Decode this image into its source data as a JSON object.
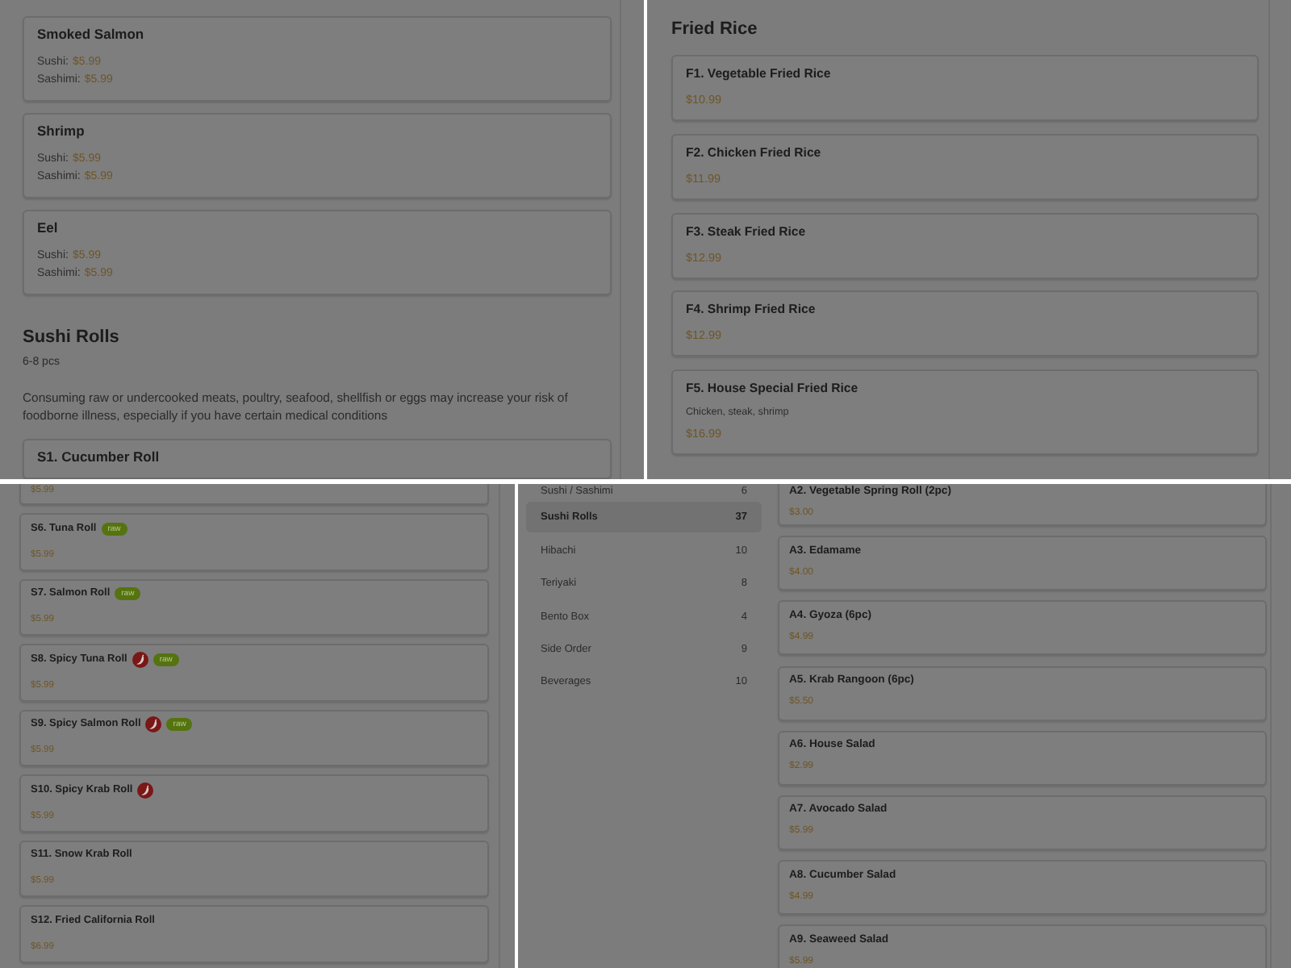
{
  "panels": [
    {
      "blocks": [
        {
          "kind": "card",
          "title": "Smoked Salmon",
          "prices": [
            {
              "label": "Sushi:",
              "price": "$5.99"
            },
            {
              "label": "Sashimi:",
              "price": "$5.99"
            }
          ]
        },
        {
          "kind": "card",
          "title": "Shrimp",
          "prices": [
            {
              "label": "Sushi:",
              "price": "$5.99"
            },
            {
              "label": "Sashimi:",
              "price": "$5.99"
            }
          ]
        },
        {
          "kind": "card",
          "title": "Eel",
          "prices": [
            {
              "label": "Sushi:",
              "price": "$5.99"
            },
            {
              "label": "Sashimi:",
              "price": "$5.99"
            }
          ]
        },
        {
          "kind": "heading",
          "text": "Sushi Rolls"
        },
        {
          "kind": "subtitle",
          "text": "6-8 pcs"
        },
        {
          "kind": "note",
          "text": "Consuming raw or undercooked meats, poultry, seafood, shellfish or eggs may increase your risk of foodborne illness, especially if you have certain medical conditions"
        },
        {
          "kind": "card",
          "title": "S1. Cucumber Roll"
        }
      ]
    },
    {
      "blocks": [
        {
          "kind": "heading",
          "text": "Fried Rice"
        },
        {
          "kind": "card",
          "title": "F1. Vegetable Fried Rice",
          "price": "$10.99"
        },
        {
          "kind": "card",
          "title": "F2. Chicken Fried Rice",
          "price": "$11.99"
        },
        {
          "kind": "card",
          "title": "F3. Steak Fried Rice",
          "price": "$12.99"
        },
        {
          "kind": "card",
          "title": "F4. Shrimp Fried Rice",
          "price": "$12.99"
        },
        {
          "kind": "card",
          "title": "F5. House Special Fried Rice",
          "description": "Chicken, steak, shrimp",
          "price": "$16.99"
        }
      ]
    },
    {
      "blocks": [
        {
          "kind": "card",
          "price": "$5.99"
        },
        {
          "kind": "card",
          "title": "S6. Tuna Roll",
          "tags": [
            {
              "kind": "raw",
              "label": "raw"
            }
          ],
          "price": "$5.99"
        },
        {
          "kind": "card",
          "title": "S7. Salmon Roll",
          "tags": [
            {
              "kind": "raw",
              "label": "raw"
            }
          ],
          "price": "$5.99"
        },
        {
          "kind": "card",
          "title": "S8. Spicy Tuna Roll",
          "tags": [
            {
              "kind": "spicy"
            },
            {
              "kind": "raw",
              "label": "raw"
            }
          ],
          "price": "$5.99"
        },
        {
          "kind": "card",
          "title": "S9. Spicy Salmon Roll",
          "tags": [
            {
              "kind": "spicy"
            },
            {
              "kind": "raw",
              "label": "raw"
            }
          ],
          "price": "$5.99"
        },
        {
          "kind": "card",
          "title": "S10. Spicy Krab Roll",
          "tags": [
            {
              "kind": "spicy"
            }
          ],
          "price": "$5.99"
        },
        {
          "kind": "card",
          "title": "S11. Snow Krab Roll",
          "price": "$5.99"
        },
        {
          "kind": "card",
          "title": "S12. Fried California Roll",
          "price": "$6.99"
        }
      ]
    },
    {
      "sidebar": {
        "items": [
          {
            "label": "Sushi / Sashimi",
            "count": "6",
            "selected": false
          },
          {
            "label": "Sushi Rolls",
            "count": "37",
            "selected": true
          },
          {
            "label": "Hibachi",
            "count": "10",
            "selected": false
          },
          {
            "label": "Teriyaki",
            "count": "8",
            "selected": false
          },
          {
            "label": "Bento Box",
            "count": "4",
            "selected": false
          },
          {
            "label": "Side Order",
            "count": "9",
            "selected": false
          },
          {
            "label": "Beverages",
            "count": "10",
            "selected": false
          }
        ]
      },
      "blocks": [
        {
          "kind": "card",
          "title": "A2. Vegetable Spring Roll (2pc)",
          "price": "$3.00"
        },
        {
          "kind": "card",
          "title": "A3. Edamame",
          "price": "$4.00"
        },
        {
          "kind": "card",
          "title": "A4. Gyoza (6pc)",
          "price": "$4.99"
        },
        {
          "kind": "card",
          "title": "A5. Krab Rangoon (6pc)",
          "price": "$5.50"
        },
        {
          "kind": "card",
          "title": "A6. House Salad",
          "price": "$2.99"
        },
        {
          "kind": "card",
          "title": "A7. Avocado Salad",
          "price": "$5.99"
        },
        {
          "kind": "card",
          "title": "A8. Cucumber Salad",
          "price": "$4.99"
        },
        {
          "kind": "card",
          "title": "A9. Seaweed Salad",
          "price": "$5.99"
        }
      ]
    }
  ]
}
